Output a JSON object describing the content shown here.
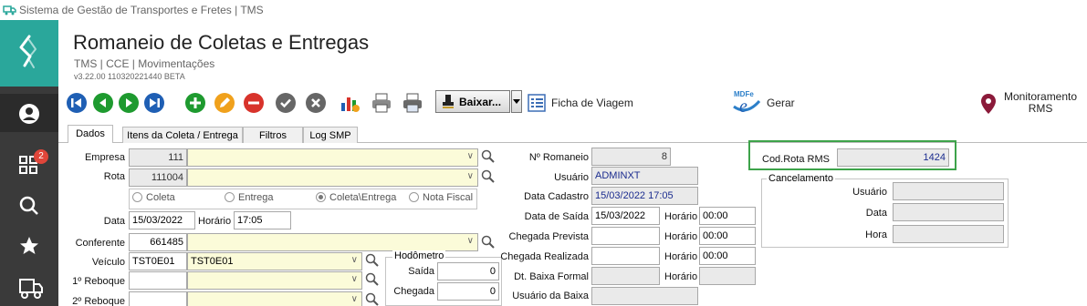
{
  "window": {
    "title": "Sistema de Gestão de Transportes e Fretes | TMS"
  },
  "sidebar": {
    "badge_count": "2"
  },
  "header": {
    "title": "Romaneio de Coletas e Entregas",
    "breadcrumb": "TMS | CCE | Movimentações",
    "version": "v3.22.00 110320221440 BETA"
  },
  "toolbar": {
    "baixar_label": "Baixar...",
    "ficha_label": "Ficha de Viagem",
    "gerar_label": "Gerar",
    "monitoramento_label_1": "Monitoramento",
    "monitoramento_label_2": "RMS"
  },
  "tabs": [
    "Dados",
    "Itens da Coleta / Entrega",
    "Filtros",
    "Log SMP"
  ],
  "form": {
    "empresa_label": "Empresa",
    "empresa_value": "111",
    "rota_label": "Rota",
    "rota_value": "111004",
    "radio_coleta": "Coleta",
    "radio_entrega": "Entrega",
    "radio_coleta_entrega": "Coleta\\Entrega",
    "radio_nota_fiscal": "Nota Fiscal",
    "data_label": "Data",
    "data_value": "15/03/2022",
    "horario_label": "Horário",
    "horario_value": "17:05",
    "conferente_label": "Conferente",
    "conferente_value": "661485",
    "veiculo_label": "Veículo",
    "veiculo_code": "TST0E01",
    "veiculo_desc": "TST0E01",
    "reboque1_label": "1º Reboque",
    "reboque2_label": "2º Reboque",
    "hodometro_title": "Hodômetro",
    "saida_label": "Saída",
    "saida_value": "0",
    "chegada_label": "Chegada",
    "chegada_value": "0",
    "romaneio_label": "Nº Romaneio",
    "romaneio_value": "8",
    "usuario_label": "Usuário",
    "usuario_value": "ADMINXT",
    "data_cadastro_label": "Data Cadastro",
    "data_cadastro_value": "15/03/2022  17:05",
    "data_saida_label": "Data de Saída",
    "data_saida_value": "15/03/2022",
    "horario_saida_value": "00:00",
    "chegada_prevista_label": "Chegada Prevista",
    "horario_prevista_value": "00:00",
    "chegada_realizada_label": "Chegada Realizada",
    "horario_realizada_value": "00:00",
    "dt_baixa_label": "Dt. Baixa Formal",
    "usuario_baixa_label": "Usuário da Baixa",
    "cod_rota_label": "Cod.Rota RMS",
    "cod_rota_value": "1424",
    "cancelamento_title": "Cancelamento",
    "canc_usuario_label": "Usuário",
    "canc_data_label": "Data",
    "canc_hora_label": "Hora"
  },
  "colors": {
    "accent": "#2aa79b",
    "sidebar": "#3a3a3a",
    "highlight_border": "#3da34a",
    "field_yellow": "#fbfbd9"
  }
}
